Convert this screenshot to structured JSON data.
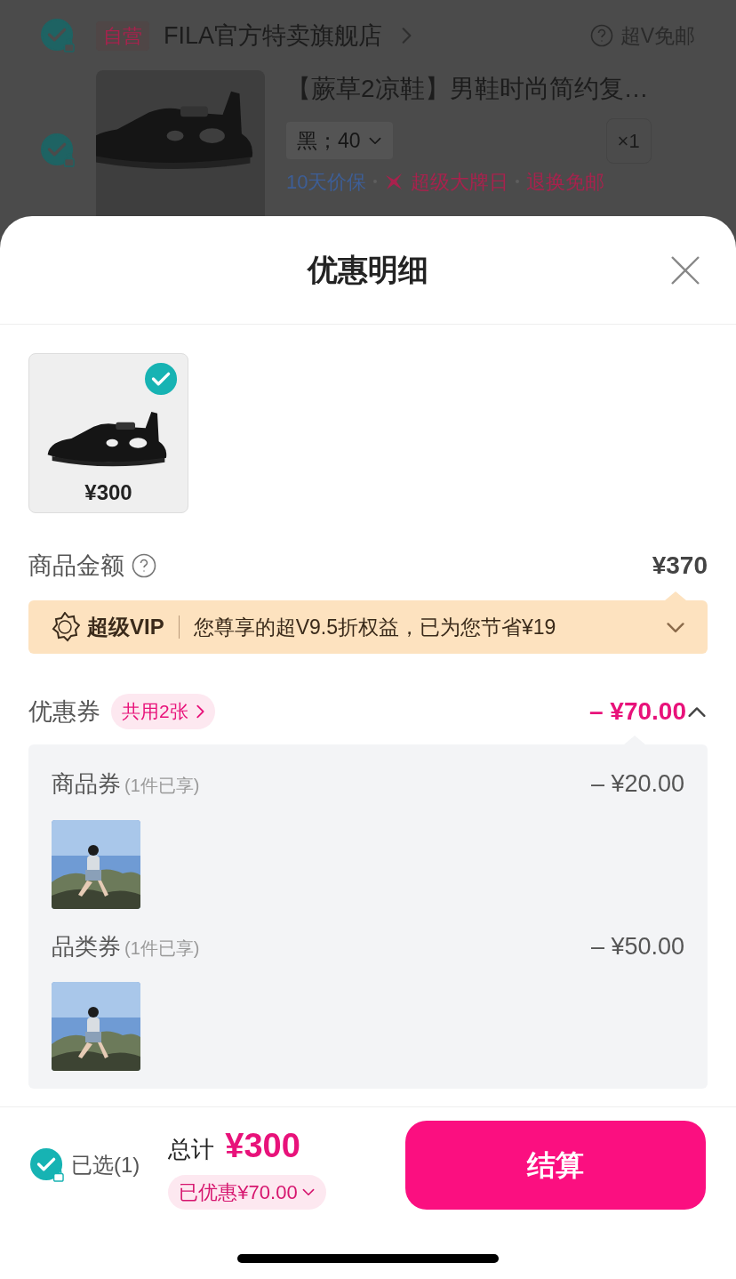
{
  "cart": {
    "store": {
      "checked": true,
      "badge": "自营",
      "name": "FILA官方特卖旗舰店",
      "shipping": "超V免邮"
    },
    "product": {
      "checked": true,
      "title": "【蕨草2凉鞋】男鞋时尚简约复…",
      "variant": "黑；40",
      "quantity": "×1",
      "tags": [
        {
          "kind": "plain",
          "text": "10天价保",
          "color": "#3d5e96"
        },
        {
          "kind": "event",
          "text": "超级大牌日",
          "color": "#a8224d"
        },
        {
          "kind": "plain",
          "text": "退换免邮",
          "color": "#a8224d"
        }
      ]
    }
  },
  "sheet": {
    "title": "优惠明细",
    "items": [
      {
        "price": "¥300",
        "selected": true
      }
    ],
    "goods_amount": {
      "label": "商品金额",
      "value": "¥370"
    },
    "vip": {
      "brand": "超级VIP",
      "message": "您尊享的超V9.5折权益，已为您节省¥19",
      "expanded": false
    },
    "coupons": {
      "label": "优惠券",
      "badge": "共用2张",
      "total": "– ¥70.00",
      "expanded": true,
      "groups": [
        {
          "name": "商品券",
          "note": "(1件已享)",
          "amount": "– ¥20.00"
        },
        {
          "name": "品类券",
          "note": "(1件已享)",
          "amount": "– ¥50.00"
        }
      ]
    }
  },
  "footer": {
    "all_checked": true,
    "selected_label": "已选(1)",
    "total_label": "总计",
    "total": "¥300",
    "discount": "已优惠¥70.00",
    "checkout": "结算"
  }
}
